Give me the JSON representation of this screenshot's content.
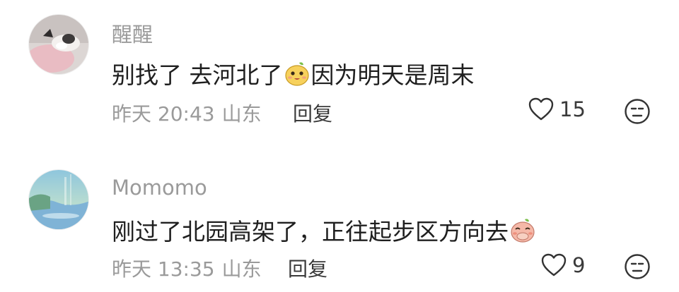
{
  "comments": [
    {
      "username": "醒醒",
      "text_before": "别找了 去河北了",
      "emoji": "smiling-peach-emoji",
      "text_after": "因为明天是周末",
      "time": "昨天 20:43",
      "location": "山东",
      "reply_label": "回复",
      "like_count": "15"
    },
    {
      "username": "Momomo",
      "text_before": "刚过了北园高架了，正往起步区方向去",
      "emoji": "covering-mouth-peach-emoji",
      "text_after": "",
      "time": "昨天 13:35",
      "location": "山东",
      "reply_label": "回复",
      "like_count": "9"
    }
  ],
  "colors": {
    "secondary_text": "#9a9a9a",
    "primary_text": "#1f1f1f",
    "background": "#ffffff"
  }
}
